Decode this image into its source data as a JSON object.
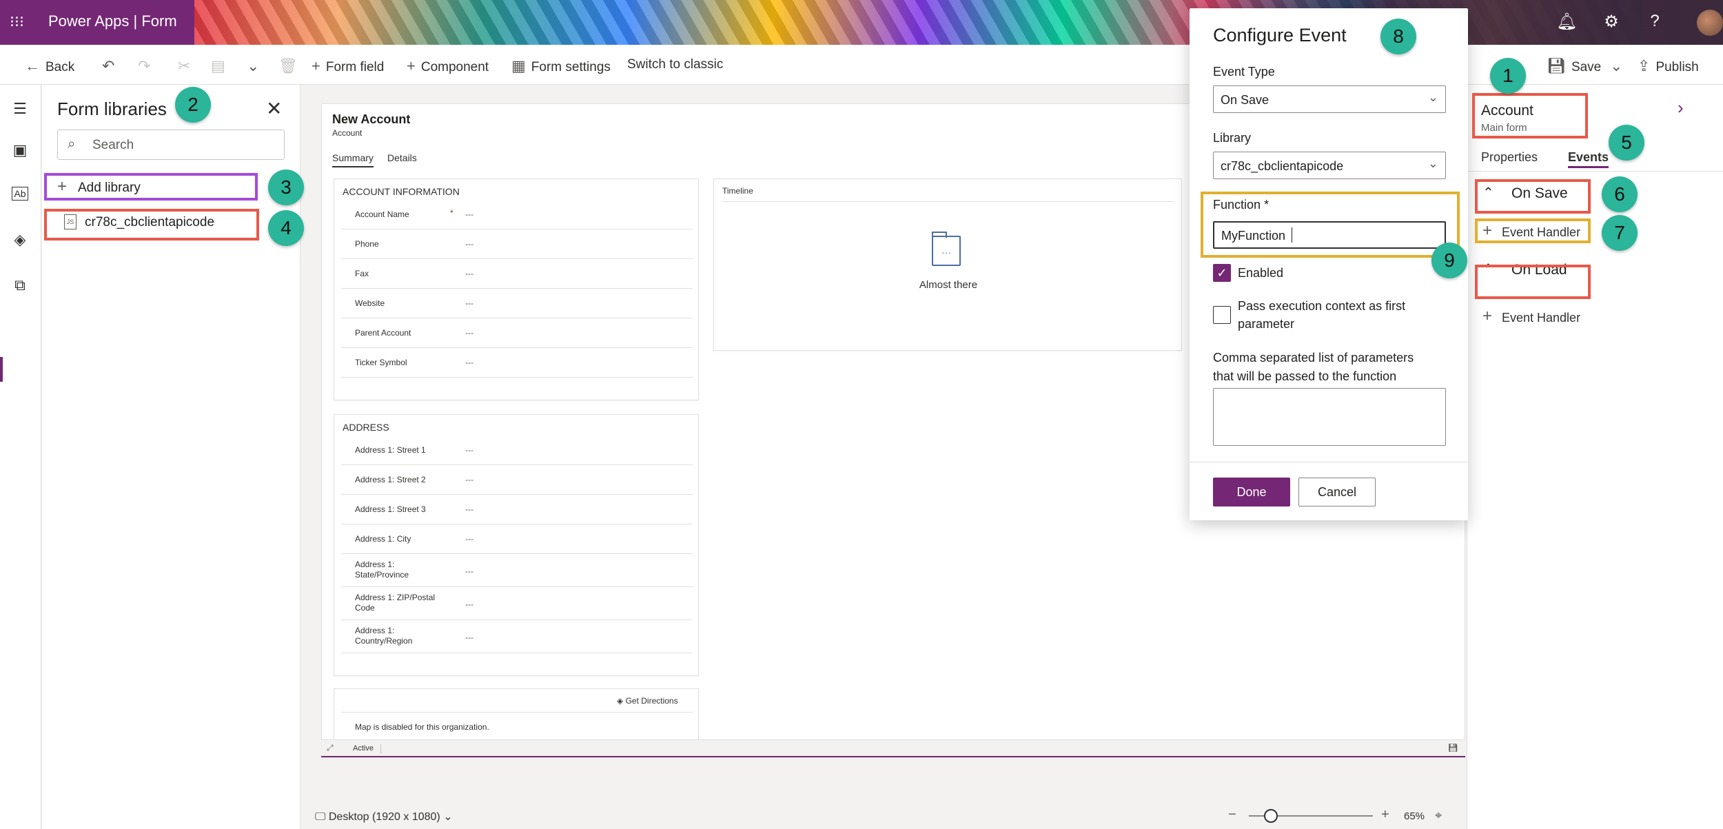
{
  "header": {
    "app_title": "Power Apps  |  Form"
  },
  "toolbar": {
    "back": "Back",
    "form_field": "Form field",
    "component": "Component",
    "form_settings": "Form settings",
    "switch_classic": "Switch to classic",
    "save": "Save",
    "publish": "Publish"
  },
  "libraries": {
    "title": "Form libraries",
    "search_placeholder": "Search",
    "add_library": "Add library",
    "items": [
      {
        "label": "cr78c_cbclientapicode"
      }
    ]
  },
  "form": {
    "title": "New Account",
    "subtitle": "Account",
    "tabs": [
      "Summary",
      "Details"
    ],
    "account_info": {
      "title": "ACCOUNT INFORMATION",
      "fields": [
        {
          "label": "Account Name",
          "value": "---"
        },
        {
          "label": "Phone",
          "value": "---"
        },
        {
          "label": "Fax",
          "value": "---"
        },
        {
          "label": "Website",
          "value": "---"
        },
        {
          "label": "Parent Account",
          "value": "---"
        },
        {
          "label": "Ticker Symbol",
          "value": "---"
        }
      ]
    },
    "address": {
      "title": "ADDRESS",
      "fields": [
        {
          "label": "Address 1: Street 1",
          "value": "---"
        },
        {
          "label": "Address 1: Street 2",
          "value": "---"
        },
        {
          "label": "Address 1: Street 3",
          "value": "---"
        },
        {
          "label": "Address 1: City",
          "value": "---"
        },
        {
          "label": "Address 1: State/Province",
          "value": "---"
        },
        {
          "label": "Address 1: ZIP/Postal Code",
          "value": "---"
        },
        {
          "label": "Address 1: Country/Region",
          "value": "---"
        }
      ]
    },
    "timeline": {
      "title": "Timeline",
      "empty_text": "Almost there"
    },
    "map": {
      "directions": "Get Directions",
      "disabled_text": "Map is disabled for this organization."
    },
    "status": "Active"
  },
  "footer": {
    "device": "Desktop (1920 x 1080)",
    "zoom": "65%",
    "zoom_level": 0.65
  },
  "properties": {
    "title": "Account",
    "subtitle": "Main form",
    "tabs": [
      "Properties",
      "Events"
    ],
    "events": [
      {
        "name": "On Save",
        "add_label": "Event Handler"
      },
      {
        "name": "On Load",
        "add_label": "Event Handler"
      }
    ]
  },
  "dialog": {
    "title": "Configure Event",
    "event_type_label": "Event Type",
    "event_type_value": "On Save",
    "library_label": "Library",
    "library_value": "cr78c_cbclientapicode",
    "function_label": "Function *",
    "function_value": "MyFunction",
    "enabled_label": "Enabled",
    "enabled": true,
    "pass_context_label": "Pass execution context as first parameter",
    "pass_context": false,
    "params_label": "Comma separated list of parameters that will be passed to the function",
    "params_value": "",
    "done": "Done",
    "cancel": "Cancel"
  },
  "callouts": [
    "1",
    "2",
    "3",
    "4",
    "5",
    "6",
    "7",
    "8",
    "9"
  ],
  "colors": {
    "accent": "#742774",
    "callout": "#2bb59a",
    "highlight_red": "#e8594a",
    "highlight_yellow": "#e0b030",
    "highlight_purple": "#a64ad6"
  }
}
